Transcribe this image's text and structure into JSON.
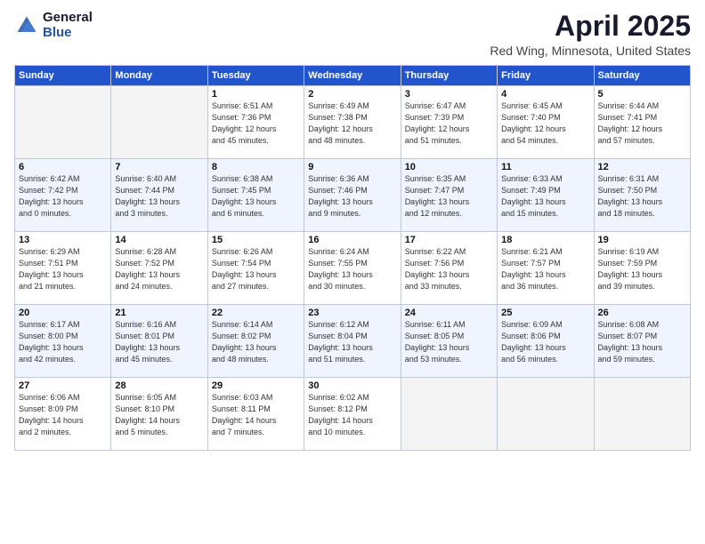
{
  "logo": {
    "general": "General",
    "blue": "Blue"
  },
  "title": {
    "month": "April 2025",
    "location": "Red Wing, Minnesota, United States"
  },
  "headers": [
    "Sunday",
    "Monday",
    "Tuesday",
    "Wednesday",
    "Thursday",
    "Friday",
    "Saturday"
  ],
  "weeks": [
    [
      {
        "day": "",
        "info": ""
      },
      {
        "day": "",
        "info": ""
      },
      {
        "day": "1",
        "info": "Sunrise: 6:51 AM\nSunset: 7:36 PM\nDaylight: 12 hours\nand 45 minutes."
      },
      {
        "day": "2",
        "info": "Sunrise: 6:49 AM\nSunset: 7:38 PM\nDaylight: 12 hours\nand 48 minutes."
      },
      {
        "day": "3",
        "info": "Sunrise: 6:47 AM\nSunset: 7:39 PM\nDaylight: 12 hours\nand 51 minutes."
      },
      {
        "day": "4",
        "info": "Sunrise: 6:45 AM\nSunset: 7:40 PM\nDaylight: 12 hours\nand 54 minutes."
      },
      {
        "day": "5",
        "info": "Sunrise: 6:44 AM\nSunset: 7:41 PM\nDaylight: 12 hours\nand 57 minutes."
      }
    ],
    [
      {
        "day": "6",
        "info": "Sunrise: 6:42 AM\nSunset: 7:42 PM\nDaylight: 13 hours\nand 0 minutes."
      },
      {
        "day": "7",
        "info": "Sunrise: 6:40 AM\nSunset: 7:44 PM\nDaylight: 13 hours\nand 3 minutes."
      },
      {
        "day": "8",
        "info": "Sunrise: 6:38 AM\nSunset: 7:45 PM\nDaylight: 13 hours\nand 6 minutes."
      },
      {
        "day": "9",
        "info": "Sunrise: 6:36 AM\nSunset: 7:46 PM\nDaylight: 13 hours\nand 9 minutes."
      },
      {
        "day": "10",
        "info": "Sunrise: 6:35 AM\nSunset: 7:47 PM\nDaylight: 13 hours\nand 12 minutes."
      },
      {
        "day": "11",
        "info": "Sunrise: 6:33 AM\nSunset: 7:49 PM\nDaylight: 13 hours\nand 15 minutes."
      },
      {
        "day": "12",
        "info": "Sunrise: 6:31 AM\nSunset: 7:50 PM\nDaylight: 13 hours\nand 18 minutes."
      }
    ],
    [
      {
        "day": "13",
        "info": "Sunrise: 6:29 AM\nSunset: 7:51 PM\nDaylight: 13 hours\nand 21 minutes."
      },
      {
        "day": "14",
        "info": "Sunrise: 6:28 AM\nSunset: 7:52 PM\nDaylight: 13 hours\nand 24 minutes."
      },
      {
        "day": "15",
        "info": "Sunrise: 6:26 AM\nSunset: 7:54 PM\nDaylight: 13 hours\nand 27 minutes."
      },
      {
        "day": "16",
        "info": "Sunrise: 6:24 AM\nSunset: 7:55 PM\nDaylight: 13 hours\nand 30 minutes."
      },
      {
        "day": "17",
        "info": "Sunrise: 6:22 AM\nSunset: 7:56 PM\nDaylight: 13 hours\nand 33 minutes."
      },
      {
        "day": "18",
        "info": "Sunrise: 6:21 AM\nSunset: 7:57 PM\nDaylight: 13 hours\nand 36 minutes."
      },
      {
        "day": "19",
        "info": "Sunrise: 6:19 AM\nSunset: 7:59 PM\nDaylight: 13 hours\nand 39 minutes."
      }
    ],
    [
      {
        "day": "20",
        "info": "Sunrise: 6:17 AM\nSunset: 8:00 PM\nDaylight: 13 hours\nand 42 minutes."
      },
      {
        "day": "21",
        "info": "Sunrise: 6:16 AM\nSunset: 8:01 PM\nDaylight: 13 hours\nand 45 minutes."
      },
      {
        "day": "22",
        "info": "Sunrise: 6:14 AM\nSunset: 8:02 PM\nDaylight: 13 hours\nand 48 minutes."
      },
      {
        "day": "23",
        "info": "Sunrise: 6:12 AM\nSunset: 8:04 PM\nDaylight: 13 hours\nand 51 minutes."
      },
      {
        "day": "24",
        "info": "Sunrise: 6:11 AM\nSunset: 8:05 PM\nDaylight: 13 hours\nand 53 minutes."
      },
      {
        "day": "25",
        "info": "Sunrise: 6:09 AM\nSunset: 8:06 PM\nDaylight: 13 hours\nand 56 minutes."
      },
      {
        "day": "26",
        "info": "Sunrise: 6:08 AM\nSunset: 8:07 PM\nDaylight: 13 hours\nand 59 minutes."
      }
    ],
    [
      {
        "day": "27",
        "info": "Sunrise: 6:06 AM\nSunset: 8:09 PM\nDaylight: 14 hours\nand 2 minutes."
      },
      {
        "day": "28",
        "info": "Sunrise: 6:05 AM\nSunset: 8:10 PM\nDaylight: 14 hours\nand 5 minutes."
      },
      {
        "day": "29",
        "info": "Sunrise: 6:03 AM\nSunset: 8:11 PM\nDaylight: 14 hours\nand 7 minutes."
      },
      {
        "day": "30",
        "info": "Sunrise: 6:02 AM\nSunset: 8:12 PM\nDaylight: 14 hours\nand 10 minutes."
      },
      {
        "day": "",
        "info": ""
      },
      {
        "day": "",
        "info": ""
      },
      {
        "day": "",
        "info": ""
      }
    ]
  ]
}
